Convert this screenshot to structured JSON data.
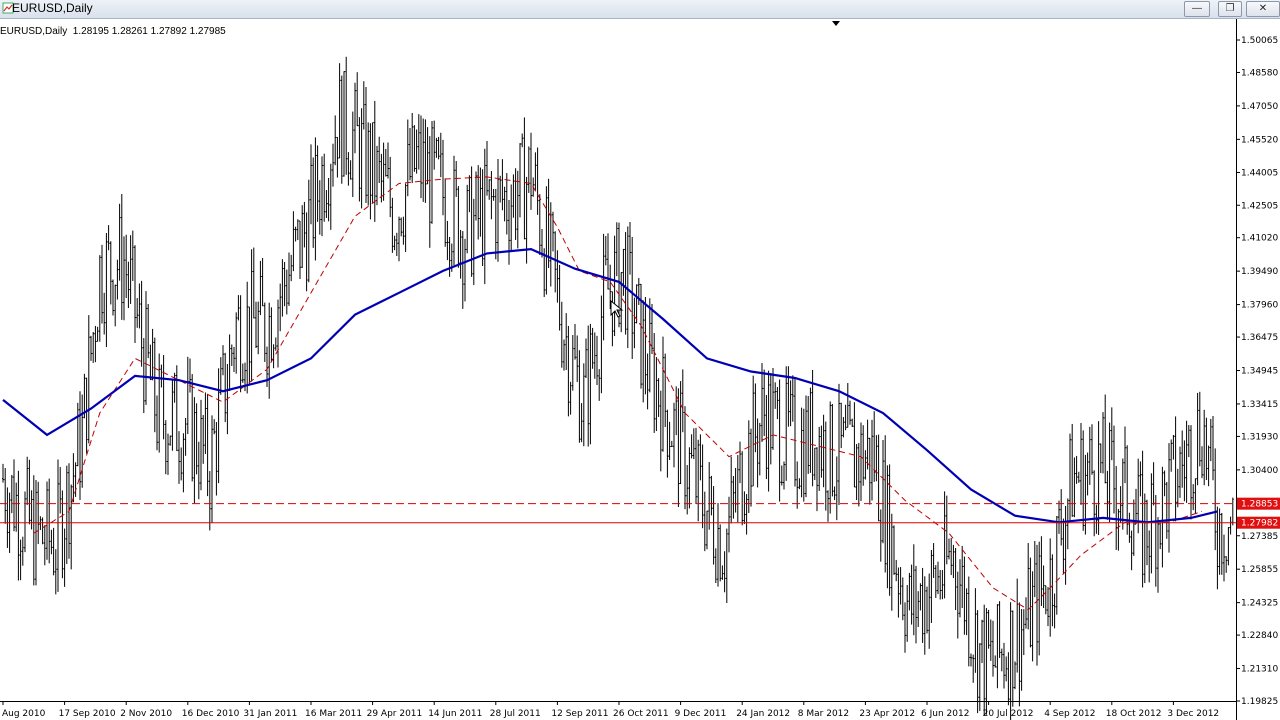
{
  "window": {
    "title": "EURUSD,Daily",
    "buttons": {
      "minimize": "—",
      "maximize": "❐",
      "close": "✕"
    }
  },
  "chart_info": {
    "symbol": "EURUSD,Daily",
    "ohlc": "1.28195 1.28261 1.27892 1.27985"
  },
  "colors": {
    "price_bars": "#000000",
    "fast_ma": "#c00000",
    "slow_ma": "#0000b4",
    "hline": "#dd0000",
    "hline_label_bg": "#e01010"
  },
  "chart_data": {
    "type": "line",
    "ylim": [
      1.19825,
      1.50065
    ],
    "y_ticks": [
      "1.50065",
      "1.48580",
      "1.47050",
      "1.45520",
      "1.44005",
      "1.42505",
      "1.41020",
      "1.39490",
      "1.37960",
      "1.36475",
      "1.34945",
      "1.33415",
      "1.31930",
      "1.30400",
      "1.28853",
      "1.27982",
      "1.27385",
      "1.25855",
      "1.24325",
      "1.22840",
      "1.21310",
      "1.19825"
    ],
    "y_tick_values": [
      1.50065,
      1.4858,
      1.4705,
      1.4552,
      1.44005,
      1.42505,
      1.4102,
      1.3949,
      1.3796,
      1.36475,
      1.34945,
      1.33415,
      1.3193,
      1.304,
      1.28853,
      1.27982,
      1.27385,
      1.25855,
      1.24325,
      1.2284,
      1.2131,
      1.19825
    ],
    "x_labels": [
      "Aug 2010",
      "17 Sep 2010",
      "2 Nov 2010",
      "16 Dec 2010",
      "31 Jan 2011",
      "16 Mar 2011",
      "29 Apr 2011",
      "14 Jun 2011",
      "28 Jul 2011",
      "12 Sep 2011",
      "26 Oct 2011",
      "9 Dec 2011",
      "24 Jan 2012",
      "8 Mar 2012",
      "23 Apr 2012",
      "6 Jun 2012",
      "20 Jul 2012",
      "4 Sep 2012",
      "18 Oct 2012",
      "3 Dec 2012"
    ],
    "x_label_index": [
      0,
      28,
      56,
      84,
      112,
      140,
      168,
      196,
      224,
      252,
      280,
      308,
      336,
      364,
      392,
      420,
      448,
      476,
      504,
      532
    ],
    "n_bars": 560,
    "price_path": [
      [
        0,
        1.3
      ],
      [
        14,
        1.275
      ],
      [
        24,
        1.27
      ],
      [
        36,
        1.32
      ],
      [
        44,
        1.395
      ],
      [
        55,
        1.4
      ],
      [
        70,
        1.33
      ],
      [
        84,
        1.325
      ],
      [
        94,
        1.305
      ],
      [
        106,
        1.37
      ],
      [
        120,
        1.37
      ],
      [
        140,
        1.42
      ],
      [
        152,
        1.465
      ],
      [
        160,
        1.455
      ],
      [
        178,
        1.422
      ],
      [
        188,
        1.445
      ],
      [
        200,
        1.43
      ],
      [
        210,
        1.412
      ],
      [
        222,
        1.425
      ],
      [
        236,
        1.432
      ],
      [
        240,
        1.44
      ],
      [
        246,
        1.41
      ],
      [
        258,
        1.355
      ],
      [
        264,
        1.335
      ],
      [
        274,
        1.385
      ],
      [
        282,
        1.395
      ],
      [
        292,
        1.355
      ],
      [
        302,
        1.33
      ],
      [
        318,
        1.29
      ],
      [
        328,
        1.27
      ],
      [
        338,
        1.31
      ],
      [
        346,
        1.33
      ],
      [
        360,
        1.315
      ],
      [
        370,
        1.32
      ],
      [
        376,
        1.31
      ],
      [
        396,
        1.31
      ],
      [
        404,
        1.27
      ],
      [
        412,
        1.24
      ],
      [
        426,
        1.255
      ],
      [
        432,
        1.265
      ],
      [
        444,
        1.22
      ],
      [
        450,
        1.215
      ],
      [
        462,
        1.23
      ],
      [
        476,
        1.255
      ],
      [
        486,
        1.3
      ],
      [
        498,
        1.305
      ],
      [
        512,
        1.29
      ],
      [
        518,
        1.275
      ],
      [
        528,
        1.29
      ],
      [
        538,
        1.31
      ],
      [
        545,
        1.325
      ],
      [
        552,
        1.28
      ]
    ],
    "series": [
      {
        "name": "",
        "values": [
          [
            0,
            1.336
          ],
          [
            20,
            1.32
          ],
          [
            40,
            1.332
          ],
          [
            60,
            1.347
          ],
          [
            80,
            1.345
          ],
          [
            100,
            1.34
          ],
          [
            120,
            1.345
          ],
          [
            140,
            1.355
          ],
          [
            160,
            1.375
          ],
          [
            180,
            1.385
          ],
          [
            200,
            1.395
          ],
          [
            220,
            1.403
          ],
          [
            240,
            1.405
          ],
          [
            260,
            1.396
          ],
          [
            280,
            1.39
          ],
          [
            300,
            1.373
          ],
          [
            320,
            1.355
          ],
          [
            340,
            1.349
          ],
          [
            360,
            1.346
          ],
          [
            380,
            1.34
          ],
          [
            400,
            1.33
          ],
          [
            420,
            1.313
          ],
          [
            440,
            1.295
          ],
          [
            460,
            1.283
          ],
          [
            480,
            1.28
          ],
          [
            500,
            1.282
          ],
          [
            520,
            1.28
          ],
          [
            540,
            1.282
          ],
          [
            552,
            1.285
          ]
        ]
      },
      {
        "name": "",
        "values": [
          [
            14,
            1.275
          ],
          [
            30,
            1.285
          ],
          [
            44,
            1.33
          ],
          [
            60,
            1.355
          ],
          [
            80,
            1.345
          ],
          [
            100,
            1.335
          ],
          [
            120,
            1.35
          ],
          [
            140,
            1.385
          ],
          [
            160,
            1.42
          ],
          [
            180,
            1.435
          ],
          [
            200,
            1.437
          ],
          [
            220,
            1.438
          ],
          [
            240,
            1.435
          ],
          [
            252,
            1.415
          ],
          [
            262,
            1.395
          ],
          [
            276,
            1.39
          ],
          [
            290,
            1.37
          ],
          [
            310,
            1.33
          ],
          [
            330,
            1.31
          ],
          [
            350,
            1.32
          ],
          [
            370,
            1.315
          ],
          [
            390,
            1.31
          ],
          [
            410,
            1.29
          ],
          [
            430,
            1.275
          ],
          [
            450,
            1.25
          ],
          [
            466,
            1.24
          ],
          [
            476,
            1.25
          ],
          [
            490,
            1.265
          ],
          [
            510,
            1.28
          ],
          [
            530,
            1.28
          ],
          [
            545,
            1.285
          ]
        ]
      }
    ],
    "hlines": [
      {
        "value": 1.28853,
        "label": "1.28853",
        "style": "dashed"
      },
      {
        "value": 1.27982,
        "label": "1.27982",
        "style": "solid"
      }
    ],
    "grid": false,
    "legend": "none"
  }
}
